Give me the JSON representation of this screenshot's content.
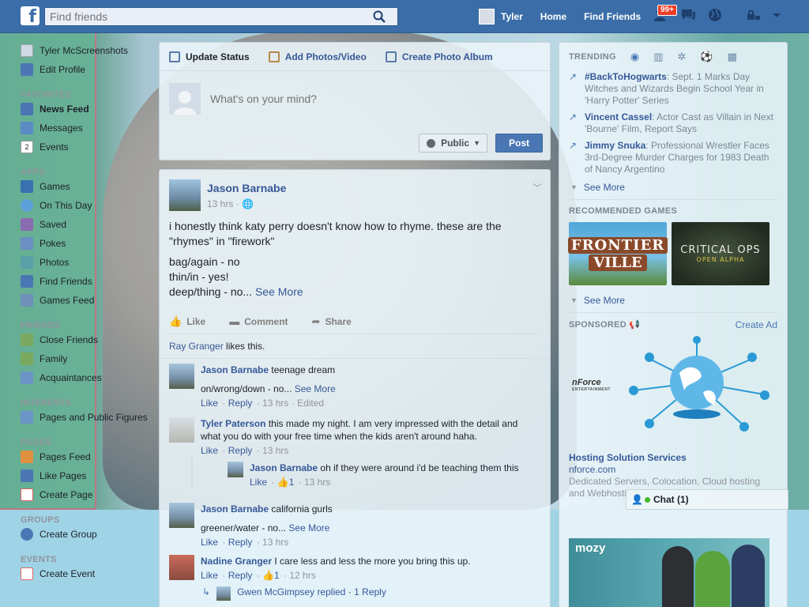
{
  "topbar": {
    "logo": "f",
    "search_placeholder": "Find friends",
    "user": "Tyler",
    "home": "Home",
    "find_friends": "Find Friends",
    "notif_badge": "99+"
  },
  "leftnav": {
    "profile_name": "Tyler McScreenshots",
    "edit_profile": "Edit Profile",
    "favorites_head": "FAVORITES",
    "favorites": [
      "News Feed",
      "Messages",
      "Events"
    ],
    "events_icon_text": "2",
    "apps_head": "APPS",
    "apps": [
      "Games",
      "On This Day",
      "Saved",
      "Pokes",
      "Photos",
      "Find Friends",
      "Games Feed"
    ],
    "friends_head": "FRIENDS",
    "friends": [
      "Close Friends",
      "Family",
      "Acquaintances"
    ],
    "interests_head": "INTERESTS",
    "interests": [
      "Pages and Public Figures"
    ],
    "pages_head": "PAGES",
    "pages": [
      "Pages Feed",
      "Like Pages",
      "Create Page"
    ],
    "groups_head": "GROUPS",
    "groups": [
      "Create Group"
    ],
    "events_head": "EVENTS",
    "events": [
      "Create Event"
    ]
  },
  "composer": {
    "tab_status": "Update Status",
    "tab_photos": "Add Photos/Video",
    "tab_album": "Create Photo Album",
    "placeholder": "What's on your mind?",
    "privacy": "Public",
    "post": "Post"
  },
  "post": {
    "author": "Jason Barnabe",
    "time": "13 hrs",
    "line1": "i honestly think katy perry doesn't know how to rhyme. these are the \"rhymes\" in \"firework\"",
    "line2": "bag/again - no",
    "line3": "thin/in - yes!",
    "line4": "deep/thing - no...",
    "see_more": "See More",
    "like": "Like",
    "comment": "Comment",
    "share": "Share",
    "liker": "Ray Granger",
    "likes_suffix": "likes this."
  },
  "comments": [
    {
      "name": "Jason Barnabe",
      "text": "teenage dream",
      "extra": "on/wrong/down - no...",
      "see_more": "See More",
      "meta_like": "Like",
      "meta_reply": "Reply",
      "time": "13 hrs",
      "edited": "Edited"
    },
    {
      "name": "Tyler Paterson",
      "text": "this made my night. I am very impressed with the detail and what you do with your free time when the kids aren't around haha.",
      "meta_like": "Like",
      "meta_reply": "Reply",
      "time": "13 hrs"
    },
    {
      "name": "Jason Barnabe",
      "text": "oh if they were around i'd be teaching them this",
      "meta_like": "Like",
      "likes": "1",
      "time": "13 hrs"
    },
    {
      "name": "Jason Barnabe",
      "text": "california gurls",
      "extra": "greener/water - no...",
      "see_more": "See More",
      "meta_like": "Like",
      "meta_reply": "Reply",
      "time": "13 hrs"
    },
    {
      "name": "Nadine Granger",
      "text": "I care less and less the more you bring this up.",
      "meta_like": "Like",
      "meta_reply": "Reply",
      "likes": "1",
      "time": "12 hrs"
    },
    {
      "name": "Gwen McGimpsey",
      "replied": "replied",
      "replies": "1 Reply"
    }
  ],
  "right": {
    "trending_head": "TRENDING",
    "trends": [
      {
        "title": "#BackToHogwarts",
        "text": ": Sept. 1 Marks Day Witches and Wizards Begin School Year in 'Harry Potter' Series"
      },
      {
        "title": "Vincent Cassel",
        "text": ": Actor Cast as Villain in Next 'Bourne' Film, Report Says"
      },
      {
        "title": "Jimmy Snuka",
        "text": ": Professional Wrestler Faces 3rd-Degree Murder Charges for 1983 Death of Nancy Argentino"
      }
    ],
    "see_more": "See More",
    "games_head": "RECOMMENDED GAMES",
    "game1_line1": "FRONTIER",
    "game1_line2": "VILLE",
    "game2_line1": "CRITICAL OPS",
    "game2_line2": "OPEN ALPHA",
    "games_see_more": "See More",
    "sponsored_head": "SPONSORED",
    "create_ad": "Create Ad",
    "ad_logo": "nForce",
    "ad_logo_sub": "ENTERTAINMENT",
    "ad_title": "Hosting Solution Services",
    "ad_domain": "nforce.com",
    "ad_text": "Dedicated Servers, Colocation, Cloud hosting and Webhosting",
    "ad2_logo": "mozy"
  },
  "chat": {
    "label": "Chat (1)"
  },
  "colors": {
    "fb_blue": "#3b6ea8",
    "link": "#365899",
    "button": "#4a77b4"
  }
}
